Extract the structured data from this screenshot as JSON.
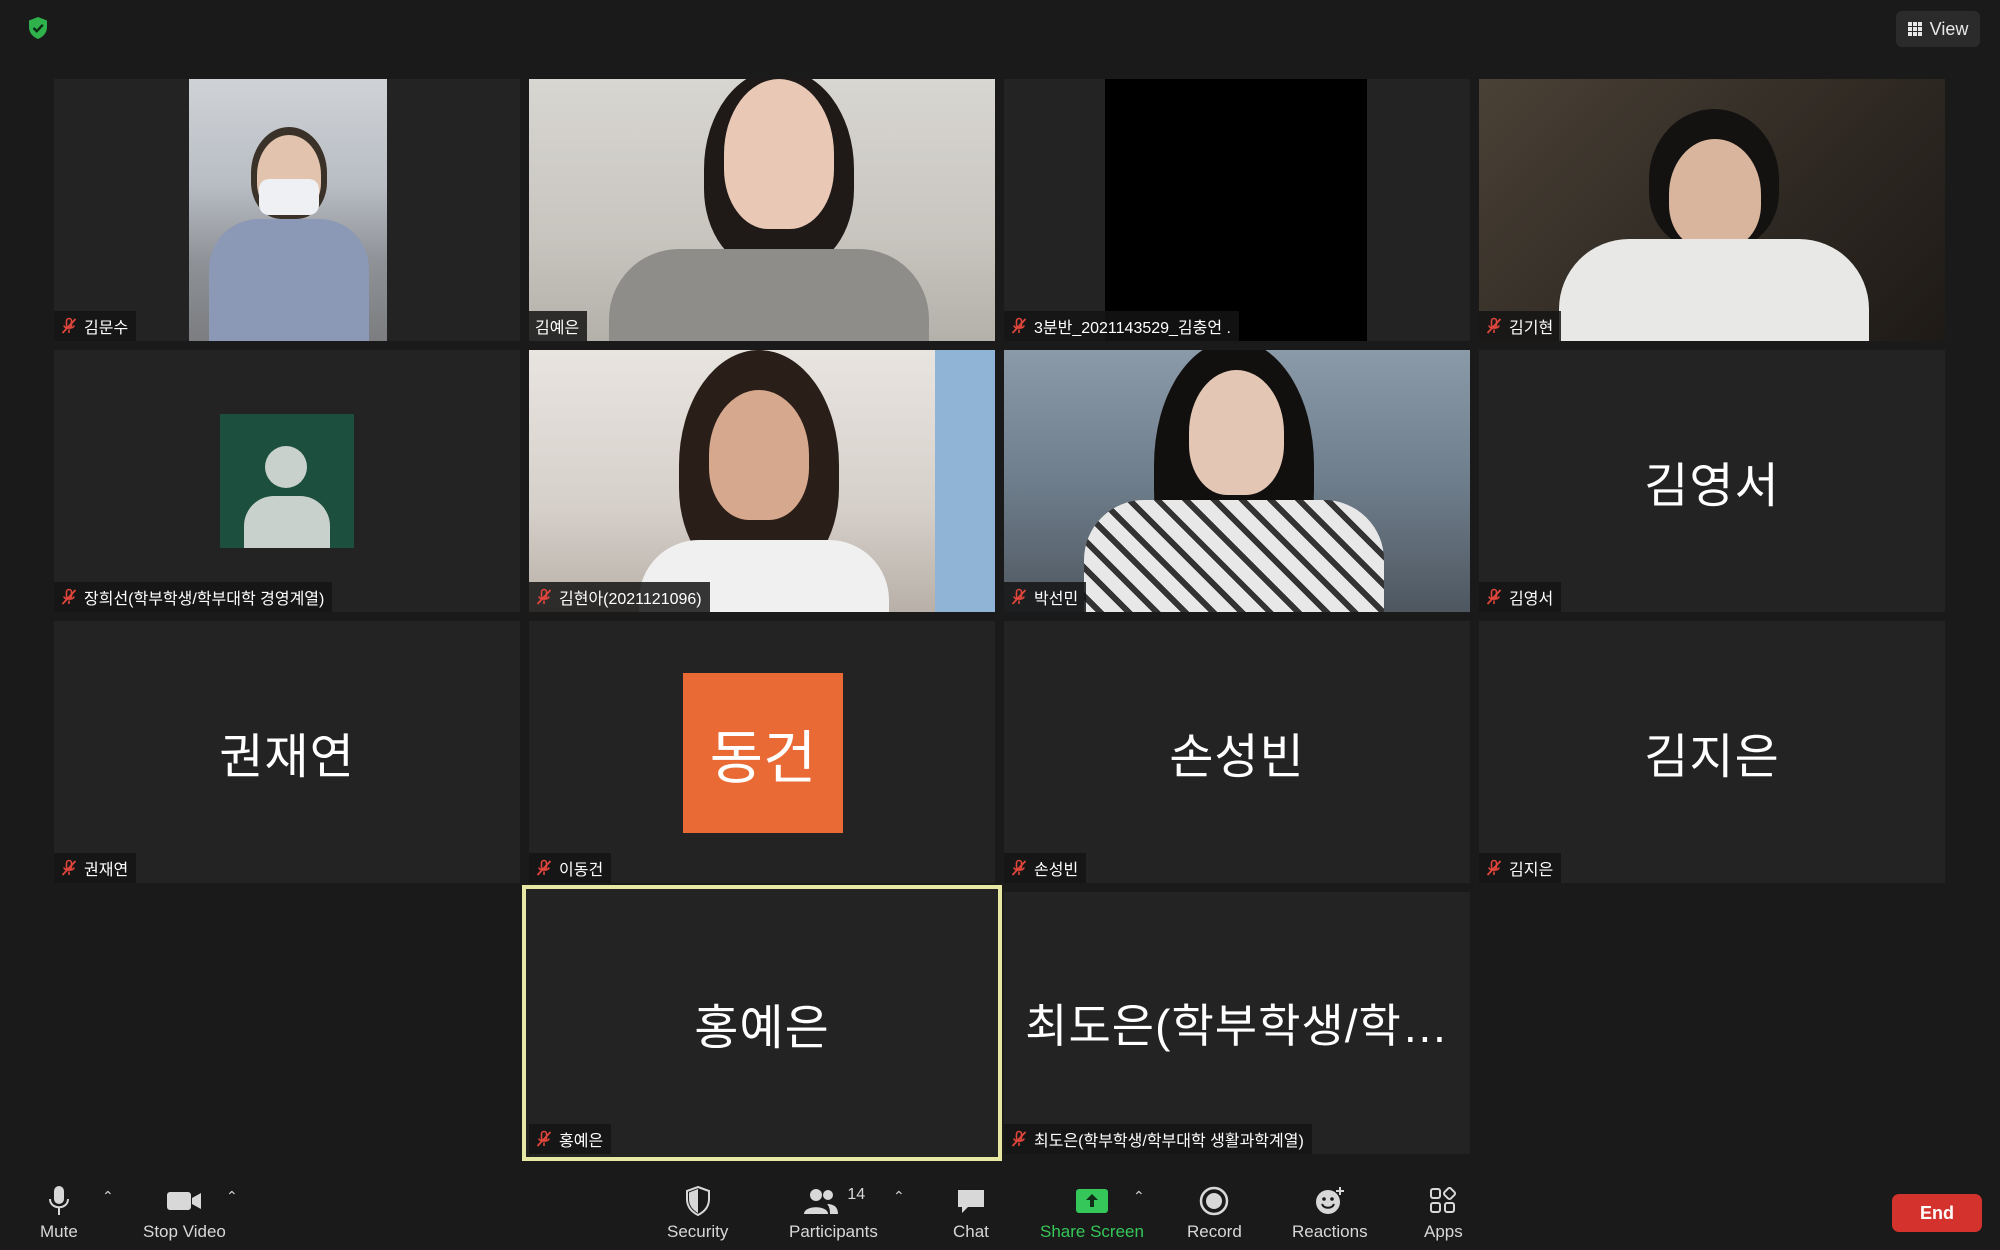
{
  "colors": {
    "accent_green": "#35c759",
    "end_red": "#d4322d",
    "speaking_outline": "#e6e8a4",
    "avatar_orange": "#e96a35",
    "avatar_green": "#1d4f3e"
  },
  "header": {
    "view_label": "View"
  },
  "tiles": [
    {
      "name": "김문수",
      "muted": true
    },
    {
      "name": "김예은",
      "muted": false
    },
    {
      "name": "3분반_2021143529_김충언 .",
      "muted": true
    },
    {
      "name": "김기현",
      "muted": true
    },
    {
      "name": "장희선(학부학생/학부대학 경영계열)",
      "muted": true
    },
    {
      "name": "김현아(2021121096)",
      "muted": true
    },
    {
      "name": "박선민",
      "muted": true
    },
    {
      "name": "김영서",
      "display": "김영서",
      "muted": true
    },
    {
      "name": "권재연",
      "display": "권재연",
      "muted": true
    },
    {
      "name": "이동건",
      "initials": "동건",
      "muted": true
    },
    {
      "name": "손성빈",
      "display": "손성빈",
      "muted": true
    },
    {
      "name": "김지은",
      "display": "김지은",
      "muted": true
    },
    {
      "name": "홍예은",
      "display": "홍예은",
      "muted": true,
      "speaking": true
    },
    {
      "name": "최도은(학부학생/학부대학 생활과학계열)",
      "display": "최도은(학부학생/학…",
      "muted": true
    }
  ],
  "toolbar": {
    "mute": "Mute",
    "stop_video": "Stop Video",
    "security": "Security",
    "participants": "Participants",
    "participants_count": "14",
    "chat": "Chat",
    "share_screen": "Share Screen",
    "record": "Record",
    "reactions": "Reactions",
    "apps": "Apps",
    "end": "End"
  }
}
